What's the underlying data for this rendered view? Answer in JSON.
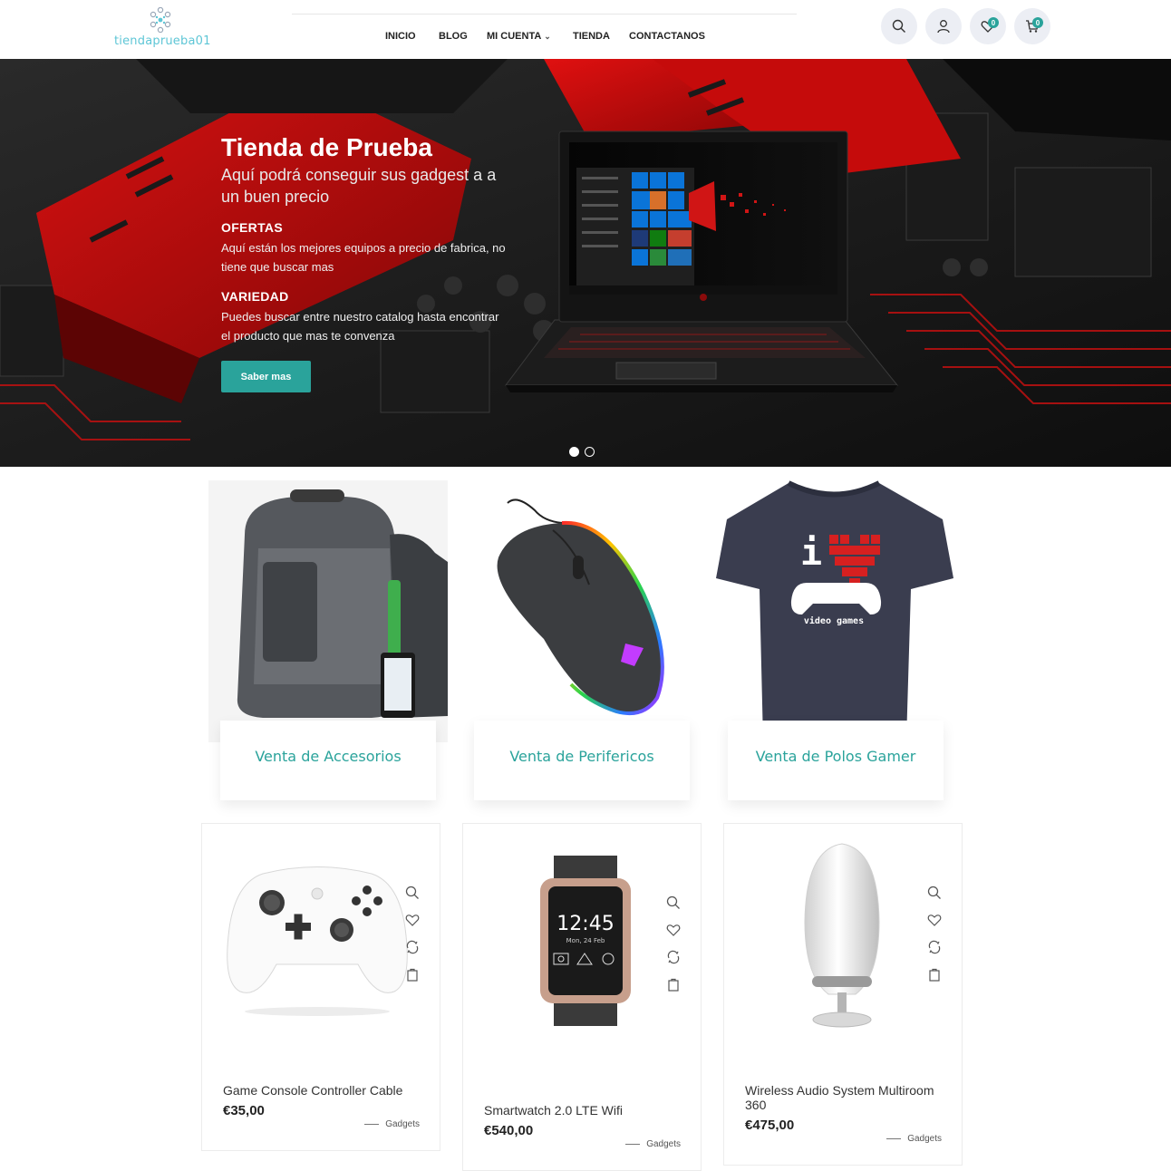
{
  "brand": {
    "logo_text": "tiendaprueba01"
  },
  "nav": {
    "items": [
      {
        "label": "INICIO"
      },
      {
        "label": "BLOG"
      },
      {
        "label": "MI CUENTA"
      },
      {
        "label": "TIENDA"
      },
      {
        "label": "CONTACTANOS"
      }
    ]
  },
  "header_icons": {
    "wishlist_count": "0",
    "cart_count": "0"
  },
  "hero": {
    "title": "Tienda de Prueba",
    "subtitle": "Aquí podrá conseguir sus gadgest a a un buen precio",
    "section1_heading": "OFERTAS",
    "section1_text": "Aquí están los mejores equipos a precio de fabrica, no tiene que buscar mas",
    "section2_heading": "VARIEDAD",
    "section2_text": "Puedes buscar entre nuestro catalog hasta encontrar el producto que mas te convenza",
    "button_label": "Saber mas",
    "slides": 2,
    "active_slide": 1
  },
  "categories": [
    {
      "title": "Venta de Accesorios"
    },
    {
      "title": "Venta de Perifericos"
    },
    {
      "title": "Venta de Polos Gamer"
    }
  ],
  "products": [
    {
      "name": "Game Console Controller Cable",
      "price": "€35,00",
      "category": "Gadgets"
    },
    {
      "name": "Smartwatch 2.0 LTE Wifi",
      "price": "€540,00",
      "category": "Gadgets"
    },
    {
      "name": "Wireless Audio System Multiroom 360",
      "price": "€475,00",
      "category": "Gadgets"
    }
  ],
  "watch_display": {
    "time": "12:45",
    "date": "Mon, 24 Feb"
  },
  "tshirt_print": {
    "letter": "i",
    "caption": "video games"
  },
  "colors": {
    "accent": "#2aa39b",
    "logo": "#5ec6d6"
  }
}
